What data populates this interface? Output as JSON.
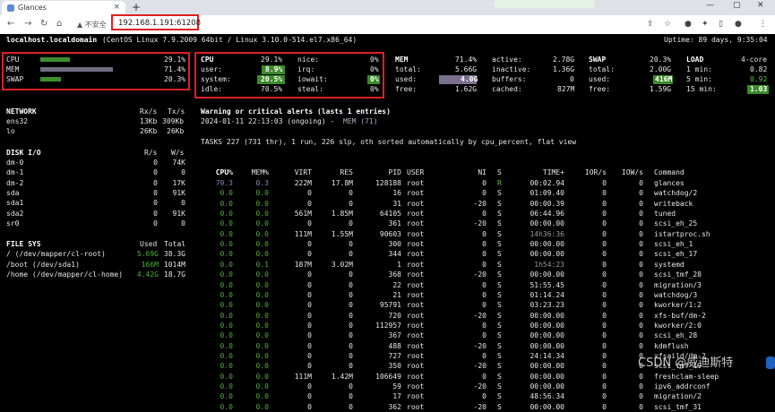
{
  "browser": {
    "tab_title": "Glances",
    "tab_close": "×",
    "new_tab": "+",
    "security_label": "不安全",
    "url": "192.168.1.191:61208",
    "min": "—",
    "max": "▢",
    "close": "✕"
  },
  "header": {
    "host": "localhost.localdomain",
    "os": "(CentOS Linux 7.9.2009 64bit / Linux 3.10.0-514.el7.x86_64)",
    "uptime": "Uptime: 89 days, 9:35:04"
  },
  "quicklook": [
    {
      "label": "CPU",
      "value": "29.1%",
      "fraction": 0.291
    },
    {
      "label": "MEM",
      "value": "71.4%",
      "fraction": 0.714
    },
    {
      "label": "SWAP",
      "value": "20.3%",
      "fraction": 0.203
    }
  ],
  "cpu": {
    "title": "CPU",
    "total": "29.1%",
    "rows": [
      {
        "l": "user:",
        "v": "8.9%",
        "r": "nice:",
        "rv": "0%"
      },
      {
        "l": "system:",
        "v": "20.5%",
        "r": "irq:",
        "rv": "0%"
      },
      {
        "l": "idle:",
        "v": "70.5%",
        "r": "iowait:",
        "rv": "0%"
      },
      {
        "l": "",
        "v": "",
        "r": "steal:",
        "rv": "0%"
      }
    ]
  },
  "mem": {
    "title": "MEM",
    "pct": "71.4%",
    "rows": [
      {
        "l": "total:",
        "v": "5.66G",
        "r": "active:",
        "rv": "2.78G"
      },
      {
        "l": "used:",
        "v": "4.0G",
        "r": "inactive:",
        "rv": "1.36G"
      },
      {
        "l": "free:",
        "v": "1.62G",
        "r": "buffers:",
        "rv": "0"
      },
      {
        "l": "",
        "v": "",
        "r": "cached:",
        "rv": "827M"
      }
    ]
  },
  "swap": {
    "title": "SWAP",
    "pct": "20.3%",
    "rows": [
      {
        "l": "total:",
        "v": "2.00G"
      },
      {
        "l": "used:",
        "v": "416M"
      },
      {
        "l": "free:",
        "v": "1.59G"
      }
    ]
  },
  "load": {
    "title": "LOAD",
    "cores": "4-core",
    "rows": [
      {
        "l": "1 min:",
        "v": "0.82"
      },
      {
        "l": "5 min:",
        "v": "0.92"
      },
      {
        "l": "15 min:",
        "v": "1.03"
      }
    ]
  },
  "network": {
    "title": "NETWORK",
    "rx": "Rx/s",
    "tx": "Tx/s",
    "rows": [
      {
        "n": "ens32",
        "rx": "13Kb",
        "tx": "309Kb"
      },
      {
        "n": "lo",
        "rx": "26Kb",
        "tx": "26Kb"
      }
    ]
  },
  "disk": {
    "title": "DISK I/O",
    "r": "R/s",
    "w": "W/s",
    "rows": [
      {
        "n": "dm-0",
        "r": "0",
        "w": "74K"
      },
      {
        "n": "dm-1",
        "r": "0",
        "w": "0"
      },
      {
        "n": "dm-2",
        "r": "0",
        "w": "17K"
      },
      {
        "n": "sda",
        "r": "0",
        "w": "91K"
      },
      {
        "n": "sda1",
        "r": "0",
        "w": "0"
      },
      {
        "n": "sda2",
        "r": "0",
        "w": "91K"
      },
      {
        "n": "sr0",
        "r": "0",
        "w": "0"
      }
    ]
  },
  "fs": {
    "title": "FILE SYS",
    "used": "Used",
    "total": "Total",
    "rows": [
      {
        "n": "/ (/dev/mapper/cl-root)",
        "u": "5.69G",
        "t": "38.3G"
      },
      {
        "n": "/boot (/dev/sda1)",
        "u": "166M",
        "t": "1014M"
      },
      {
        "n": "/home (/dev/mapper/cl-home)",
        "u": "4.42G",
        "t": "18.7G"
      }
    ]
  },
  "alerts": {
    "title": "Warning or critical alerts (lasts 1 entries)",
    "entry_time": "2024-01-11 22:13:03 (ongoing) - ",
    "entry_kind": "MEM (71)"
  },
  "tasks": "TASKS 227 (731 thr), 1 run, 226 slp, oth sorted automatically by cpu_percent, flat view",
  "proc_headers": [
    "CPU%",
    "MEM%",
    "VIRT",
    "RES",
    "PID",
    "USER",
    "NI",
    "S",
    "TIME+",
    "IOR/s",
    "IOW/s",
    "Command"
  ],
  "processes": [
    [
      "79.3",
      "0.3",
      "222M",
      "17.8M",
      "128188",
      "root",
      "0",
      "R",
      "00:02.94",
      "0",
      "0",
      "glances"
    ],
    [
      "0.0",
      "0.0",
      "0",
      "0",
      "16",
      "root",
      "0",
      "S",
      "01:09.40",
      "0",
      "0",
      "watchdog/2"
    ],
    [
      "0.0",
      "0.0",
      "0",
      "0",
      "31",
      "root",
      "-20",
      "S",
      "00:00.39",
      "0",
      "0",
      "writeback"
    ],
    [
      "0.0",
      "0.0",
      "561M",
      "1.85M",
      "64105",
      "root",
      "0",
      "S",
      "06:44.96",
      "0",
      "0",
      "tuned"
    ],
    [
      "0.0",
      "0.0",
      "0",
      "0",
      "361",
      "root",
      "-20",
      "S",
      "00:00.00",
      "0",
      "0",
      "scsi_eh_25"
    ],
    [
      "0.0",
      "0.0",
      "111M",
      "1.55M",
      "90603",
      "root",
      "0",
      "S",
      "14h36:36",
      "0",
      "0",
      "istartproc.sh"
    ],
    [
      "0.0",
      "0.0",
      "0",
      "0",
      "300",
      "root",
      "0",
      "S",
      "00:00.00",
      "0",
      "0",
      "scsi_eh_1"
    ],
    [
      "0.0",
      "0.0",
      "0",
      "0",
      "344",
      "root",
      "0",
      "S",
      "00:00.00",
      "0",
      "0",
      "scsi_eh_17"
    ],
    [
      "0.0",
      "0.1",
      "187M",
      "3.02M",
      "1",
      "root",
      "0",
      "S",
      "1h54:23",
      "0",
      "0",
      "systemd"
    ],
    [
      "0.0",
      "0.0",
      "0",
      "0",
      "368",
      "root",
      "-20",
      "S",
      "00:00.00",
      "0",
      "0",
      "scsi_tmf_28"
    ],
    [
      "0.0",
      "0.0",
      "0",
      "0",
      "22",
      "root",
      "0",
      "S",
      "51:55.45",
      "0",
      "0",
      "migration/3"
    ],
    [
      "0.0",
      "0.0",
      "0",
      "0",
      "21",
      "root",
      "0",
      "S",
      "01:14.24",
      "0",
      "0",
      "watchdog/3"
    ],
    [
      "0.0",
      "0.0",
      "0",
      "0",
      "95791",
      "root",
      "0",
      "S",
      "03:23.23",
      "0",
      "0",
      "kworker/1:2"
    ],
    [
      "0.0",
      "0.0",
      "0",
      "0",
      "720",
      "root",
      "-20",
      "S",
      "00:00.00",
      "0",
      "0",
      "xfs-buf/dm-2"
    ],
    [
      "0.0",
      "0.0",
      "0",
      "0",
      "112957",
      "root",
      "0",
      "S",
      "00:00.00",
      "0",
      "0",
      "kworker/2:0"
    ],
    [
      "0.0",
      "0.0",
      "0",
      "0",
      "367",
      "root",
      "0",
      "S",
      "00:00.00",
      "0",
      "0",
      "scsi_eh_28"
    ],
    [
      "0.0",
      "0.0",
      "0",
      "0",
      "488",
      "root",
      "-20",
      "S",
      "00:00.00",
      "0",
      "0",
      "kdmflush"
    ],
    [
      "0.0",
      "0.0",
      "0",
      "0",
      "727",
      "root",
      "0",
      "S",
      "24:14.34",
      "0",
      "0",
      "xfsaild/dm-2"
    ],
    [
      "0.0",
      "0.0",
      "0",
      "0",
      "350",
      "root",
      "-20",
      "S",
      "00:00.00",
      "0",
      "0",
      "scsi_tmf_19"
    ],
    [
      "0.0",
      "0.0",
      "111M",
      "1.42M",
      "106649",
      "root",
      "0",
      "S",
      "00:00.00",
      "0",
      "0",
      "freshclam-sleep"
    ],
    [
      "0.0",
      "0.0",
      "0",
      "0",
      "59",
      "root",
      "-20",
      "S",
      "00:00.00",
      "0",
      "0",
      "ipv6_addrconf"
    ],
    [
      "0.0",
      "0.0",
      "0",
      "0",
      "17",
      "root",
      "0",
      "S",
      "48:56.34",
      "0",
      "0",
      "migration/2"
    ],
    [
      "0.0",
      "0.0",
      "0",
      "0",
      "362",
      "root",
      "-20",
      "S",
      "00:00.00",
      "0",
      "0",
      "scsi_tmf_31"
    ]
  ],
  "watermark": "CSDN @威迪斯特",
  "colors": {
    "bar_cpu": "#3f8f2e",
    "bar_mem": "#6e6e80",
    "bar_swap": "#3f8f2e",
    "hl_green": "#3c8a2a",
    "hl_purple": "#7b6f8e",
    "red_box": "#e02020"
  }
}
